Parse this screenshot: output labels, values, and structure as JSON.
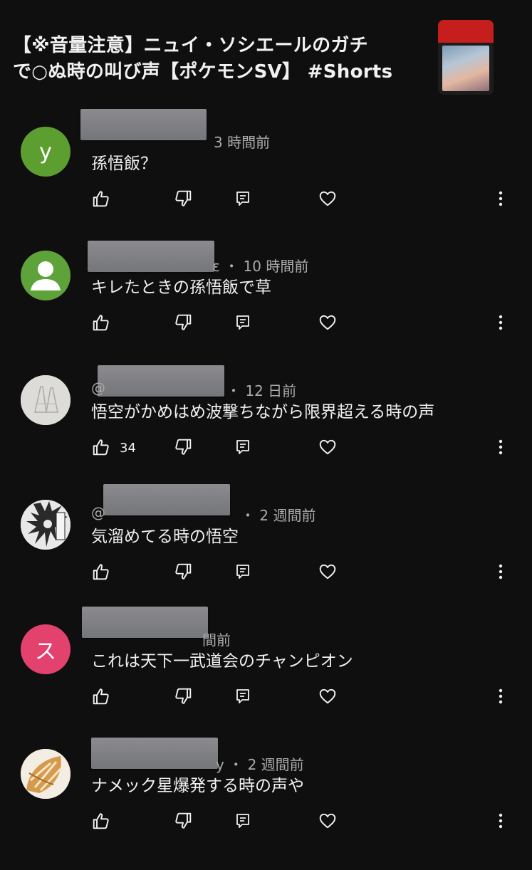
{
  "video": {
    "title_line1": "【※音量注意】ニュイ・ソシエールのガチ",
    "title_line2": "で○ぬ時の叫び声【ポケモンSV】 #Shorts"
  },
  "colors": {
    "background": "#0f0f0f",
    "meta_text": "#aaaaaa",
    "avatar_y": "#5c9e2f",
    "avatar_default": "#5ea33a",
    "avatar_su": "#e2426d"
  },
  "comments": [
    {
      "avatar_letter": "y",
      "prefix": "",
      "suffix": "",
      "time": "3 時間前",
      "text": "孫悟飯？",
      "likes": ""
    },
    {
      "avatar_letter": "",
      "prefix": "",
      "suffix": "ɛ ・",
      "time": "10 時間前",
      "text": "キレたときの孫悟飯で草",
      "likes": ""
    },
    {
      "avatar_letter": "",
      "prefix": "@",
      "suffix": "・",
      "time": "12 日前",
      "text": "悟空がかめはめ波撃ちながら限界超える時の声",
      "likes": "34"
    },
    {
      "avatar_letter": "",
      "prefix": "@",
      "suffix": "・",
      "time": "2 週間前",
      "text": "気溜めてる時の悟空",
      "likes": ""
    },
    {
      "avatar_letter": "ス",
      "prefix": "",
      "suffix": "",
      "time": "間前",
      "text": "これは天下一武道会のチャンピオン",
      "likes": ""
    },
    {
      "avatar_letter": "",
      "prefix": "",
      "suffix": "y ・",
      "time": "2 週間前",
      "text": "ナメック星爆発する時の声や",
      "likes": ""
    }
  ]
}
